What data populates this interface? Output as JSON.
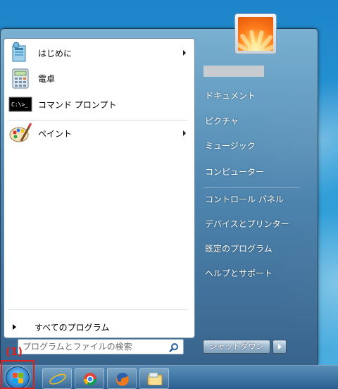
{
  "start_menu": {
    "programs": [
      {
        "label": "はじめに",
        "icon": "getting-started-icon",
        "has_submenu": true
      },
      {
        "label": "電卓",
        "icon": "calculator-icon",
        "has_submenu": false
      },
      {
        "label": "コマンド プロンプト",
        "icon": "command-prompt-icon",
        "has_submenu": false
      },
      {
        "label": "ペイント",
        "icon": "paint-icon",
        "has_submenu": true
      }
    ],
    "cmd_icon_text": "C:\\>_",
    "all_programs_label": "すべてのプログラム",
    "search": {
      "placeholder": "プログラムとファイルの検索",
      "value": ""
    },
    "right_items": [
      "ドキュメント",
      "ピクチャ",
      "ミュージック",
      "コンピューター",
      "コントロール パネル",
      "デバイスとプリンター",
      "既定のプログラム",
      "ヘルプとサポート"
    ],
    "shutdown_label": "シャットダウン"
  },
  "annotation": {
    "label": "(1)",
    "color": "#e0201b"
  },
  "taskbar": {
    "pinned": [
      "internet-explorer-icon",
      "chrome-icon",
      "firefox-icon",
      "windows-explorer-icon"
    ]
  }
}
